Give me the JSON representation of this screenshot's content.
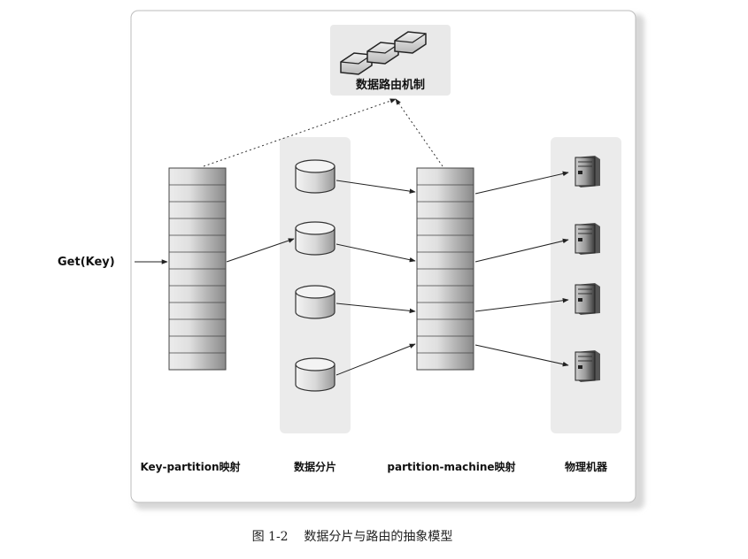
{
  "routing_box": {
    "label": "数据路由机制"
  },
  "input_label": "Get(Key)",
  "columns": {
    "key_partition": "Key-partition映射",
    "data_shards": "数据分片",
    "partition_machine": "partition-machine映射",
    "physical_machines": "物理机器"
  },
  "caption": "图 1-2    数据分片与路由的抽象模型"
}
